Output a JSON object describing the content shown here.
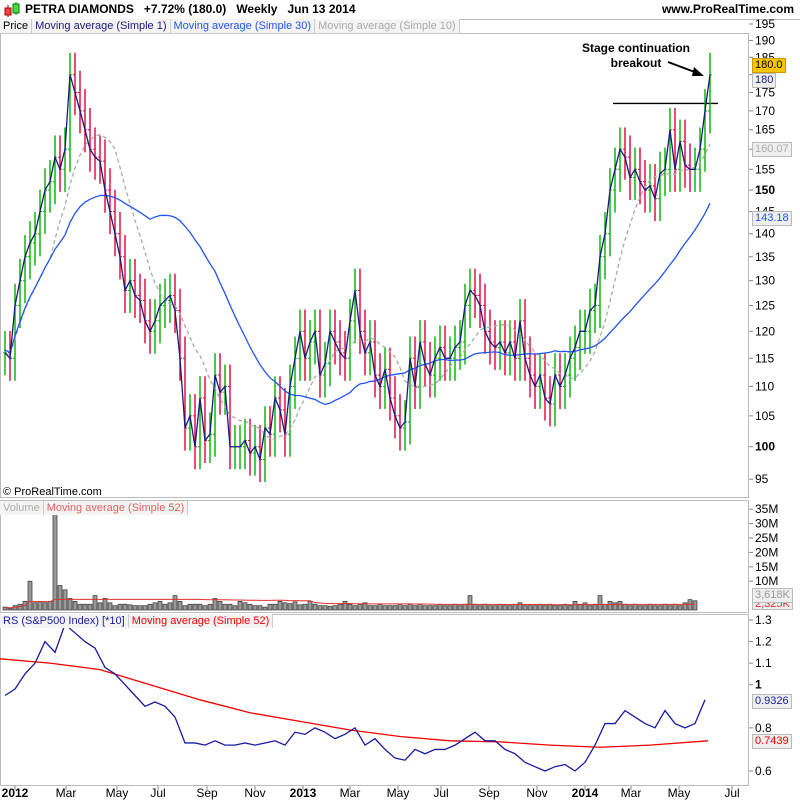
{
  "header": {
    "name": "PETRA DIAMONDS",
    "change": "+7.72% (180.0)",
    "period": "Weekly",
    "date": "Jun 13 2014",
    "site": "www.ProRealTime.com"
  },
  "price_legend": [
    "Price",
    "Moving average (Simple 1)",
    "Moving average (Simple 30)",
    "Moving average (Simple 10)"
  ],
  "volume_legend": [
    "Volume",
    "Moving average (Simple 52)"
  ],
  "rs_legend": [
    "RS (S&P500 Index) [*10]",
    "Moving average (Simple 52)"
  ],
  "copyright": "© ProRealTime.com",
  "annotation": "Stage continuation\nbreakout",
  "badges": {
    "last": "180.0",
    "ma1": "180",
    "ma10": "160.07",
    "ma30": "143.18",
    "vol": "3,618K",
    "vol_ma": "2,325K",
    "rs": "0.9326",
    "rs_ma": "0.7439"
  },
  "colors": {
    "up": "#00b000",
    "down": "#e0003a",
    "ma1": "#1a1a7a",
    "ma30": "#2255ee",
    "ma10": "#aaaaaa",
    "vol_ma": "#e03030",
    "rs": "#1a1aa0",
    "rs_ma": "#ee0000",
    "last_badge": "#f5c400"
  },
  "chart_data": {
    "type": "candlestick",
    "price_ticks": [
      "195",
      "190",
      "185",
      "180",
      "175",
      "170",
      "165",
      "160",
      "155",
      "150",
      "145",
      "140",
      "135",
      "130",
      "125",
      "120",
      "115",
      "110",
      "105",
      "100",
      "95"
    ],
    "volume_ticks": [
      "35M",
      "30M",
      "25M",
      "20M",
      "15M",
      "10M"
    ],
    "rs_ticks": [
      "1.3",
      "1.2",
      "1.1",
      "1",
      "0.9",
      "0.8",
      "0.7",
      "0.6"
    ],
    "x_labels": [
      "2012",
      "Mar",
      "May",
      "Jul",
      "Sep",
      "Nov",
      "2013",
      "Mar",
      "May",
      "Jul",
      "Sep",
      "Nov",
      "2014",
      "Mar",
      "May",
      "Jul"
    ],
    "resistance": 172,
    "closes": [
      116,
      115,
      125,
      130,
      135,
      138,
      140,
      145,
      150,
      152,
      158,
      155,
      160,
      180,
      175,
      170,
      165,
      160,
      158,
      157,
      150,
      145,
      140,
      135,
      128,
      130,
      127,
      126,
      122,
      120,
      122,
      125,
      126,
      127,
      124,
      115,
      103,
      105,
      100,
      108,
      101,
      102,
      112,
      109,
      110,
      100,
      100,
      100,
      101,
      99,
      100,
      98,
      103,
      102,
      108,
      106,
      102,
      110,
      115,
      120,
      115,
      118,
      120,
      112,
      114,
      120,
      118,
      116,
      115,
      122,
      128,
      120,
      116,
      118,
      112,
      110,
      113,
      108,
      105,
      103,
      104,
      115,
      110,
      118,
      114,
      112,
      115,
      117,
      115,
      115,
      117,
      118,
      125,
      128,
      127,
      125,
      120,
      118,
      117,
      118,
      116,
      118,
      115,
      122,
      115,
      112,
      110,
      112,
      108,
      107,
      112,
      110,
      112,
      115,
      117,
      120,
      120,
      124,
      125,
      135,
      140,
      150,
      155,
      160,
      158,
      153,
      155,
      152,
      150,
      151,
      148,
      154,
      155,
      165,
      155,
      162,
      156,
      155,
      155,
      160,
      170,
      180
    ],
    "volume_m": [
      1,
      0.5,
      1.5,
      2,
      3,
      10,
      2.5,
      3,
      2.5,
      3,
      36,
      8.5,
      7,
      4,
      3,
      2,
      2,
      2,
      5,
      2.5,
      4,
      2.5,
      1.5,
      2,
      2,
      1.8,
      1.5,
      1.5,
      1.5,
      2,
      2.5,
      3,
      2,
      2.5,
      5,
      3,
      1.5,
      2,
      2,
      2,
      1.5,
      2,
      4,
      3,
      2,
      2,
      1.5,
      3,
      2.5,
      2,
      1.5,
      1.5,
      1,
      2,
      2,
      3,
      2.5,
      2.2,
      2.8,
      1.8,
      2,
      3,
      2,
      1.5,
      1.5,
      1.3,
      1.5,
      2,
      3,
      2,
      1.5,
      2,
      2.5,
      1.5,
      1.5,
      2,
      1.5,
      1.5,
      1.5,
      2,
      1.5,
      2,
      1.5,
      2,
      1.5,
      1.5,
      1.5,
      2,
      1.5,
      1.5,
      2,
      1.5,
      2,
      5,
      2,
      1.5,
      2,
      1.5,
      1.5,
      2,
      1.5,
      1.5,
      2,
      2.5,
      1.5,
      1.5,
      1.5,
      2,
      1.5,
      2,
      1.5,
      1.5,
      2,
      1.5,
      3,
      2,
      2.5,
      1.5,
      2,
      5,
      2,
      3,
      2.5,
      3,
      2,
      1.5,
      2,
      1.5,
      1.5,
      2,
      1.5,
      1.5,
      2,
      1.5,
      2,
      1.5,
      2.5,
      3.6,
      3.2
    ],
    "rs": [
      0.95,
      0.98,
      1.05,
      1.1,
      1.2,
      1.15,
      1.28,
      1.24,
      1.2,
      1.17,
      1.08,
      1.05,
      1.0,
      0.95,
      0.9,
      0.92,
      0.9,
      0.85,
      0.73,
      0.73,
      0.72,
      0.74,
      0.72,
      0.72,
      0.73,
      0.72,
      0.73,
      0.74,
      0.72,
      0.78,
      0.77,
      0.8,
      0.78,
      0.75,
      0.77,
      0.8,
      0.72,
      0.75,
      0.7,
      0.66,
      0.65,
      0.7,
      0.68,
      0.7,
      0.7,
      0.72,
      0.75,
      0.78,
      0.74,
      0.74,
      0.7,
      0.68,
      0.64,
      0.62,
      0.6,
      0.62,
      0.63,
      0.6,
      0.64,
      0.72,
      0.82,
      0.82,
      0.88,
      0.85,
      0.82,
      0.8,
      0.88,
      0.82,
      0.8,
      0.82,
      0.93
    ],
    "rs_ma": [
      1.12,
      1.1,
      1.07,
      1.0,
      0.93,
      0.87,
      0.83,
      0.79,
      0.76,
      0.74,
      0.735,
      0.72,
      0.71,
      0.72,
      0.74
    ]
  }
}
